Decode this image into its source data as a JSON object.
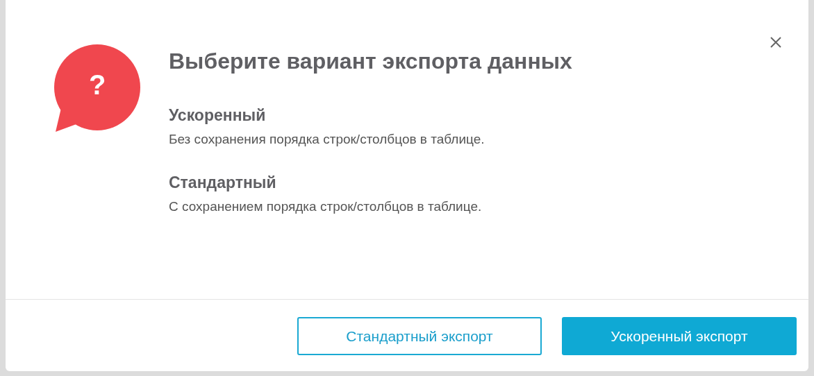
{
  "dialog": {
    "title": "Выберите вариант экспорта данных",
    "options": [
      {
        "heading": "Ускоренный",
        "description": "Без сохранения порядка строк/столбцов в таблице."
      },
      {
        "heading": "Стандартный",
        "description": "С сохранением порядка строк/столбцов в таблице."
      }
    ],
    "buttons": [
      {
        "label": "Стандартный экспорт",
        "kind": "secondary"
      },
      {
        "label": "Ускоренный экспорт",
        "kind": "primary"
      }
    ],
    "icon_mark": "?"
  }
}
